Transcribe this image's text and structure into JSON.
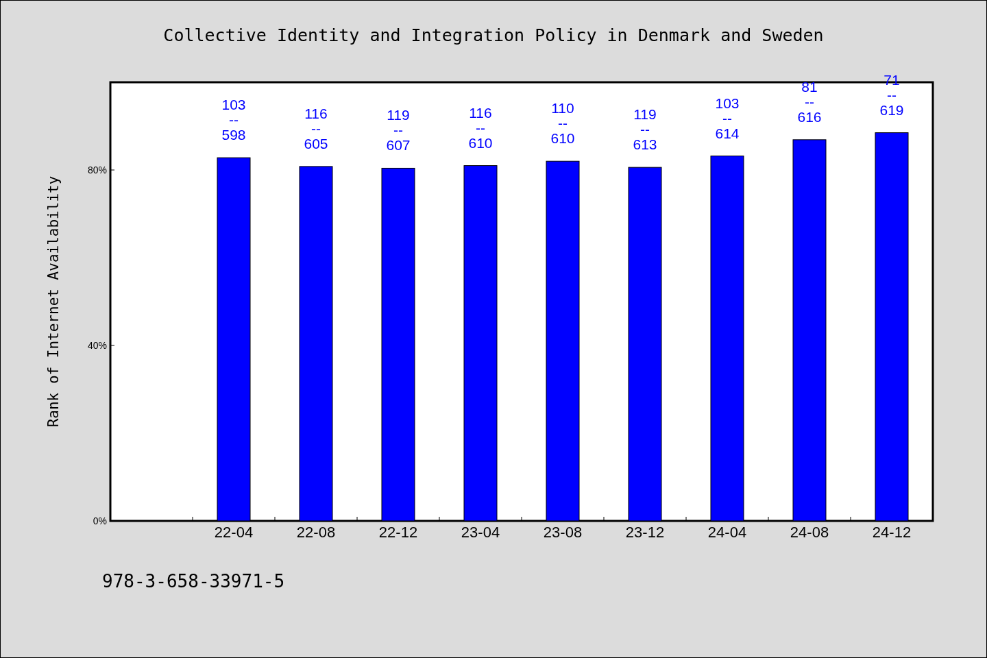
{
  "title": "Collective Identity and Integration Policy in Denmark and Sweden",
  "chart_data": {
    "type": "bar",
    "ylabel": "Rank of Internet Availability",
    "categories": [
      "22-04",
      "22-08",
      "22-12",
      "23-04",
      "23-08",
      "23-12",
      "24-04",
      "24-08",
      "24-12"
    ],
    "series": [
      {
        "color": "#0000ff",
        "values": [
          0.828,
          0.808,
          0.804,
          0.81,
          0.82,
          0.806,
          0.832,
          0.869,
          0.885
        ]
      }
    ],
    "ylim": [
      0,
      1
    ],
    "yticks": [
      {
        "value": 0,
        "label": "0%"
      },
      {
        "value": 0.4,
        "label": "40%"
      },
      {
        "value": 0.8,
        "label": "80%"
      }
    ],
    "value_labels": [
      "103\n--\n598",
      "116\n--\n605",
      "119\n--\n607",
      "116\n--\n610",
      "110\n--\n610",
      "119\n--\n613",
      "103\n--\n614",
      "81\n--\n616",
      "71\n--\n619"
    ]
  },
  "footer": "978-3-658-33971-5"
}
